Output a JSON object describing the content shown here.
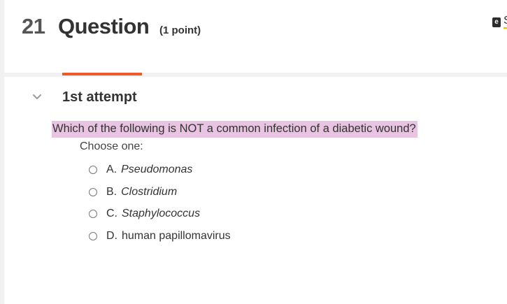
{
  "header": {
    "question_number": "21",
    "question_title": "Question",
    "points": "(1 point)",
    "ebook_icon_letter": "e",
    "ebook_label_partial": "S"
  },
  "attempt": {
    "label": "1st attempt",
    "tab_color": "#f05a28"
  },
  "question": {
    "text": "Which of the following is NOT a common infection of a diabetic wound?",
    "highlight_color": "#e8c3e2",
    "instruction": "Choose one:",
    "options": [
      {
        "letter": "A.",
        "text": "Pseudomonas",
        "italic": true,
        "selected": false
      },
      {
        "letter": "B.",
        "text": "Clostridium",
        "italic": true,
        "selected": false
      },
      {
        "letter": "C.",
        "text": "Staphylococcus",
        "italic": true,
        "selected": false
      },
      {
        "letter": "D.",
        "text": "human papillomavirus",
        "italic": false,
        "selected": false
      }
    ]
  }
}
